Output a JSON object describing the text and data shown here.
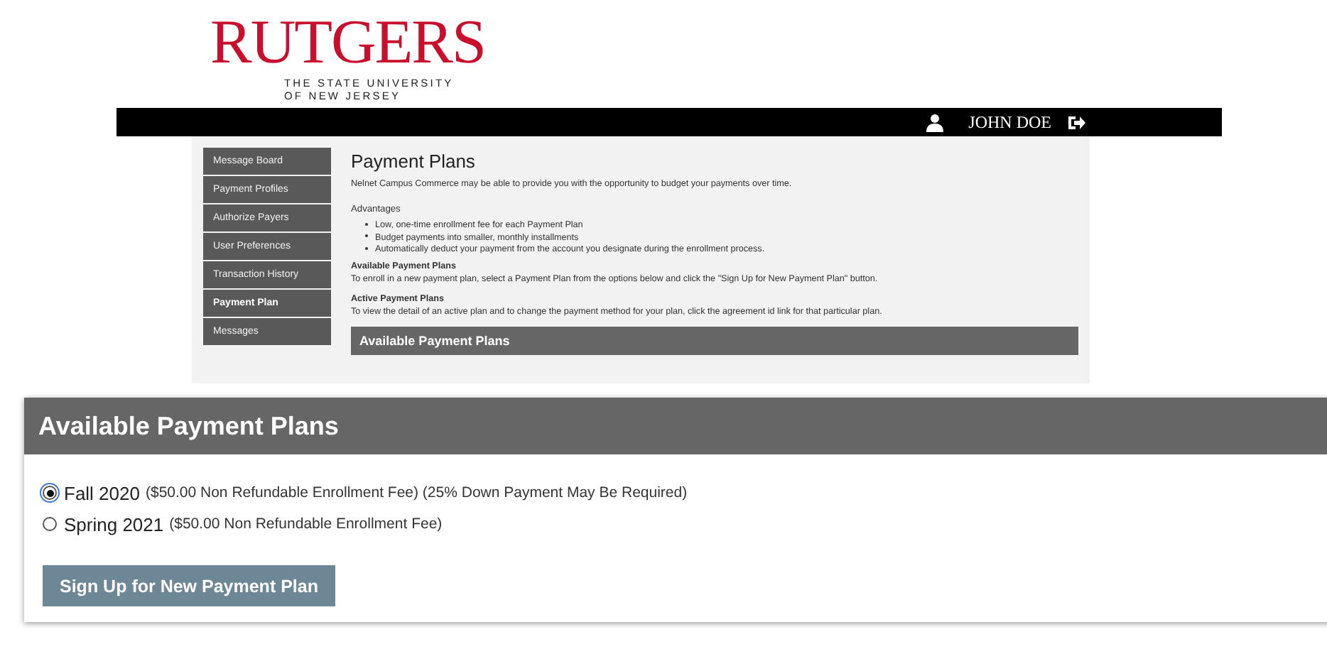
{
  "logo": {
    "name": "RUTGERS",
    "subtitle_lines": [
      "THE STATE UNIVERSITY",
      "OF NEW JERSEY"
    ]
  },
  "top_bar": {
    "user": "JOHN DOE"
  },
  "sidebar": {
    "items": [
      {
        "label": "Message Board",
        "selected": false
      },
      {
        "label": "Payment Profiles",
        "selected": false
      },
      {
        "label": "Authorize Payers",
        "selected": false
      },
      {
        "label": "User Preferences",
        "selected": false
      },
      {
        "label": "Transaction History",
        "selected": false
      },
      {
        "label": "Payment Plan",
        "selected": true
      },
      {
        "label": "Messages",
        "selected": false
      }
    ]
  },
  "content": {
    "title": "Payment Plans",
    "intro": "Nelnet Campus Commerce may be able to provide you with the opportunity to budget your payments over time.",
    "advantages_heading": "Advantages",
    "advantages": [
      "Low, one-time enrollment fee for each Payment Plan",
      "Budget payments into smaller, monthly installments",
      "Automatically deduct your payment from the account you designate during the enrollment process."
    ],
    "sections": [
      {
        "heading": "Available Payment Plans",
        "text": "To enroll in a new payment plan, select a Payment Plan from the options below and click the \"Sign Up for New Payment Plan\" button."
      },
      {
        "heading": "Active Payment Plans",
        "text": "To view the detail of an active plan and to change the payment method for your plan, click the agreement id link for that particular plan."
      }
    ],
    "panel_title": "Available Payment Plans"
  },
  "zoomed_panel": {
    "title": "Available Payment Plans",
    "plans": [
      {
        "name": "Fall 2020",
        "details": "($50.00 Non Refundable Enrollment Fee) (25% Down Payment May Be Required)",
        "selected": true
      },
      {
        "name": "Spring 2021",
        "details": "($50.00 Non Refundable Enrollment Fee)",
        "selected": false
      }
    ],
    "button": "Sign Up for New Payment Plan"
  }
}
